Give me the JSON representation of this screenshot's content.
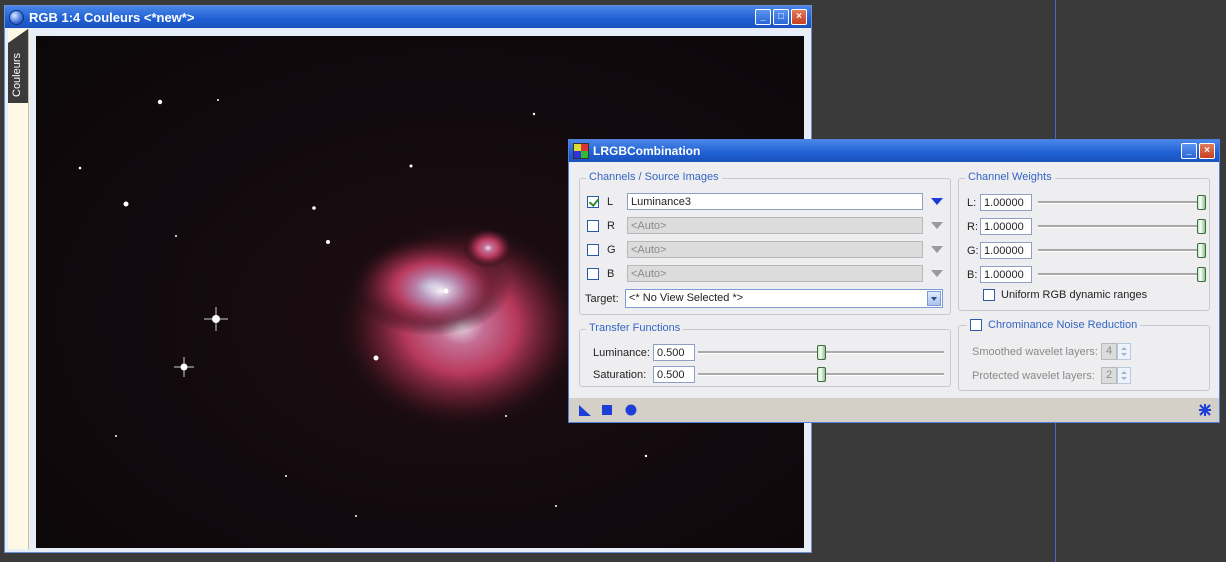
{
  "image_window": {
    "title": "RGB 1:4 Couleurs <*new*>",
    "side_tab_label": "Couleurs",
    "controls": [
      "minimize-icon",
      "maximize-icon",
      "close-icon"
    ]
  },
  "dialog": {
    "title": "LRGBCombination",
    "controls": [
      "minimize-icon",
      "close-icon"
    ],
    "channels": {
      "title": "Channels / Source Images",
      "rows": [
        {
          "label": "L",
          "checked": true,
          "value": "Luminance3",
          "enabled": true
        },
        {
          "label": "R",
          "checked": false,
          "value": "<Auto>",
          "enabled": false
        },
        {
          "label": "G",
          "checked": false,
          "value": "<Auto>",
          "enabled": false
        },
        {
          "label": "B",
          "checked": false,
          "value": "<Auto>",
          "enabled": false
        }
      ],
      "target_label": "Target:",
      "target_value": "<* No View Selected *>"
    },
    "channel_weights": {
      "title": "Channel Weights",
      "rows": [
        {
          "label": "L:",
          "value": "1.00000",
          "level": 1.0
        },
        {
          "label": "R:",
          "value": "1.00000",
          "level": 1.0
        },
        {
          "label": "G:",
          "value": "1.00000",
          "level": 1.0
        },
        {
          "label": "B:",
          "value": "1.00000",
          "level": 1.0
        }
      ],
      "uniform_label": "Uniform RGB dynamic ranges",
      "uniform_checked": false
    },
    "transfer_functions": {
      "title": "Transfer Functions",
      "rows": [
        {
          "label": "Luminance:",
          "value": "0.500",
          "level": 0.5
        },
        {
          "label": "Saturation:",
          "value": "0.500",
          "level": 0.5
        }
      ]
    },
    "chrominance": {
      "title": "Chrominance Noise Reduction",
      "checked": false,
      "smoothed_label": "Smoothed wavelet layers:",
      "smoothed_value": "4",
      "protected_label": "Protected wavelet layers:",
      "protected_value": "2"
    },
    "bottom_icons": [
      "new-instance-icon",
      "apply-square-icon",
      "apply-global-icon",
      "reset-icon"
    ]
  },
  "colors": {
    "titlebar": "#1f5fd3",
    "accent": "#3465c2",
    "nebula": "#b8395c"
  }
}
